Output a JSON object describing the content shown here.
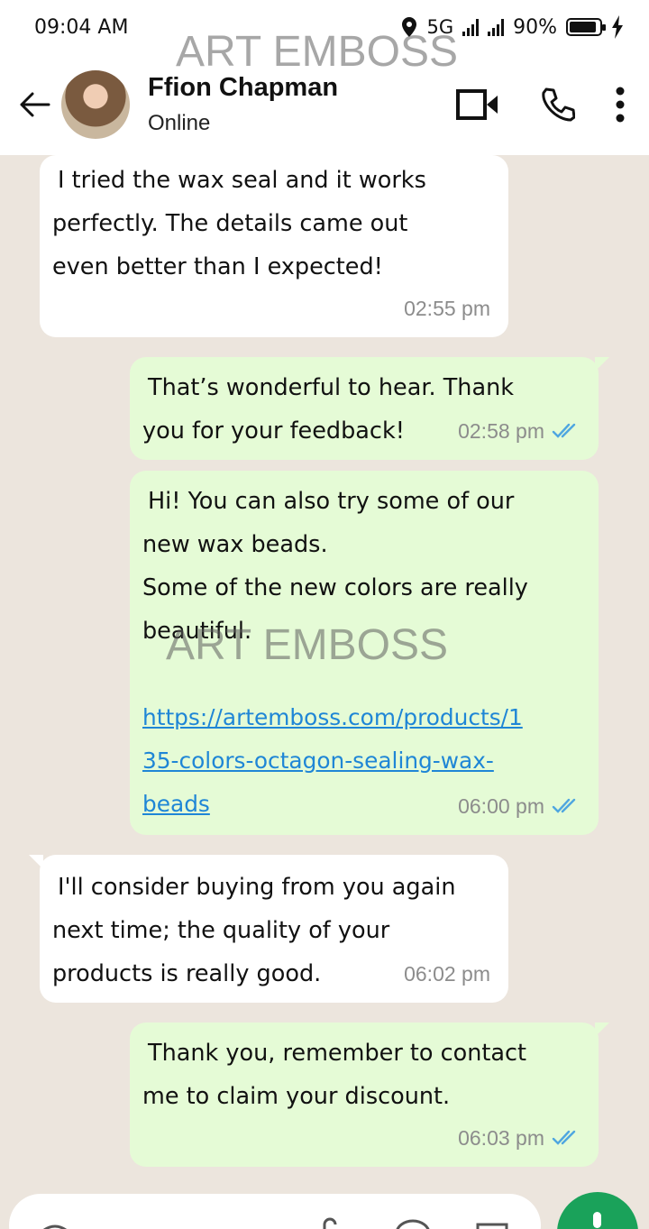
{
  "status_bar": {
    "time": "09:04 AM",
    "network": "5G",
    "battery": "90%",
    "battery_level": 0.9,
    "icons": [
      "location-icon",
      "signal-icon",
      "signal-icon",
      "battery-icon",
      "charging-icon"
    ]
  },
  "header": {
    "contact_name": "Ffion Chapman",
    "contact_status": "Online",
    "icons": [
      "back-arrow-icon",
      "avatar",
      "video-call-icon",
      "phone-call-icon",
      "more-vertical-icon"
    ]
  },
  "watermark": {
    "text": "ART EMBOSS"
  },
  "messages": [
    {
      "direction": "incoming",
      "lines": [
        "I tried the wax seal and it works",
        "perfectly. The details came out",
        "even better than I expected!"
      ],
      "time": "02:55 pm"
    },
    {
      "direction": "outgoing",
      "lines": [
        "That’s wonderful to hear. Thank",
        "you for your feedback!"
      ],
      "time": "02:58 pm",
      "read": true
    },
    {
      "direction": "outgoing",
      "lines": [
        "Hi! You can also try some of our",
        "new wax beads.",
        "Some of the new colors are really",
        "beautiful."
      ],
      "link_lines": [
        "https://artemboss.com/products/1",
        "35-colors-octagon-sealing-wax-",
        "beads"
      ],
      "time": "06:00 pm",
      "read": true
    },
    {
      "direction": "incoming",
      "lines": [
        "I'll consider buying from you again",
        "next time; the quality of your",
        "products is really good."
      ],
      "time": "06:02 pm"
    },
    {
      "direction": "outgoing",
      "lines": [
        "Thank you, remember to contact",
        "me to claim your discount."
      ],
      "time": "06:03 pm",
      "read": true
    }
  ],
  "colors": {
    "background": "#ece5dd",
    "incoming_bubble": "#ffffff",
    "outgoing_bubble": "#e5fbd6",
    "link": "#1f86d6",
    "read_ticks": "#4fa6e0",
    "mic_button": "#1aa25a"
  },
  "input_bar": {
    "icons": [
      "emoji-icon",
      "attach-icon",
      "camera-icon",
      "mic-icon"
    ]
  }
}
